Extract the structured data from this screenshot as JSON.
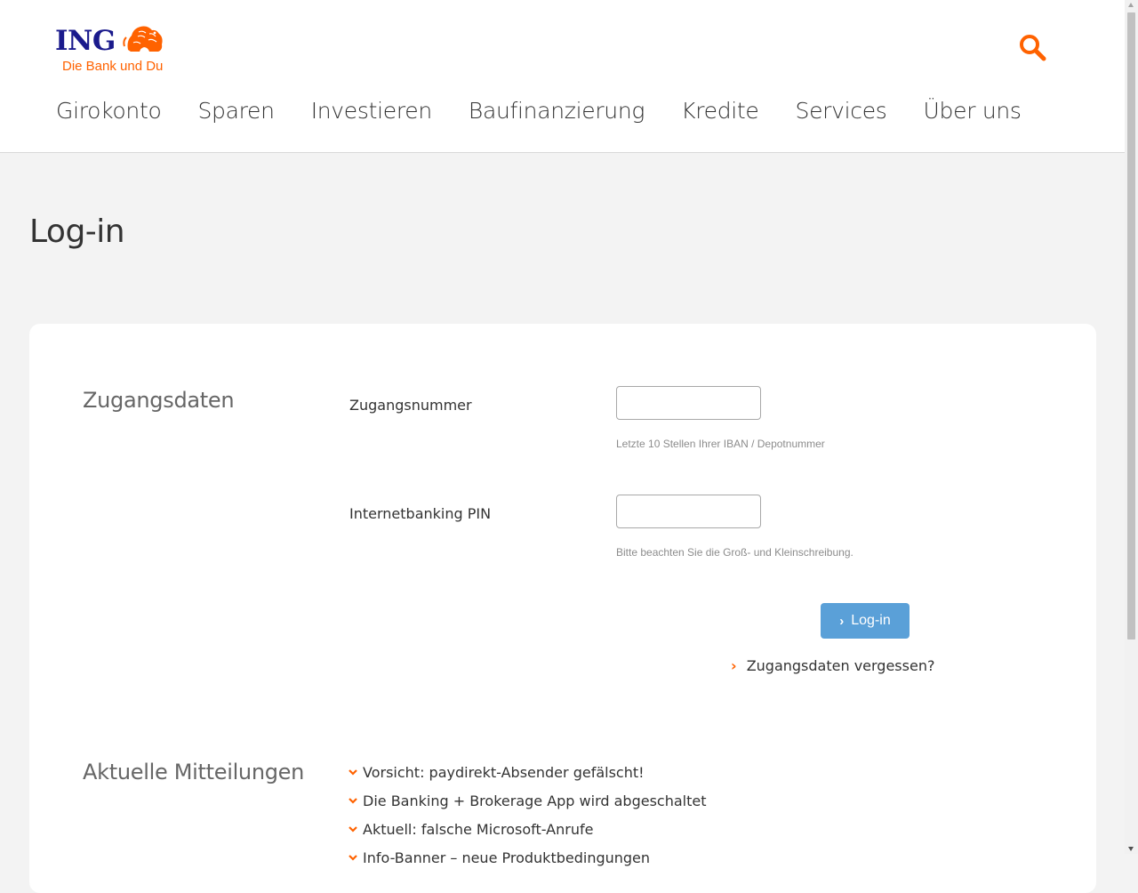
{
  "colors": {
    "brand_orange": "#ff6200",
    "brand_blue": "#1a1a8c",
    "button_blue": "#5aa0d8",
    "page_background": "#f3f3f3"
  },
  "header": {
    "logo_text": "ING",
    "tagline": "Die Bank und Du",
    "logo_icon": "lion-icon",
    "search_icon": "search-icon",
    "nav": [
      "Girokonto",
      "Sparen",
      "Investieren",
      "Baufinanzierung",
      "Kredite",
      "Services",
      "Über uns"
    ]
  },
  "page": {
    "title": "Log-in"
  },
  "login": {
    "section_title": "Zugangsdaten",
    "fields": [
      {
        "label": "Zugangsnummer",
        "value": "",
        "hint": "Letzte 10 Stellen Ihrer IBAN / Depotnummer"
      },
      {
        "label": "Internetbanking PIN",
        "value": "",
        "hint": "Bitte beachten Sie die Groß- und Kleinschreibung."
      }
    ],
    "button_label": "Log-in",
    "forgot_link": "Zugangsdaten vergessen?"
  },
  "news": {
    "section_title": "Aktuelle Mitteilungen",
    "items": [
      "Vorsicht: paydirekt-Absender gefälscht!",
      "Die Banking + Brokerage App wird abgeschaltet",
      "Aktuell: falsche Microsoft-Anrufe",
      "Info-Banner – neue Produktbedingungen"
    ]
  }
}
